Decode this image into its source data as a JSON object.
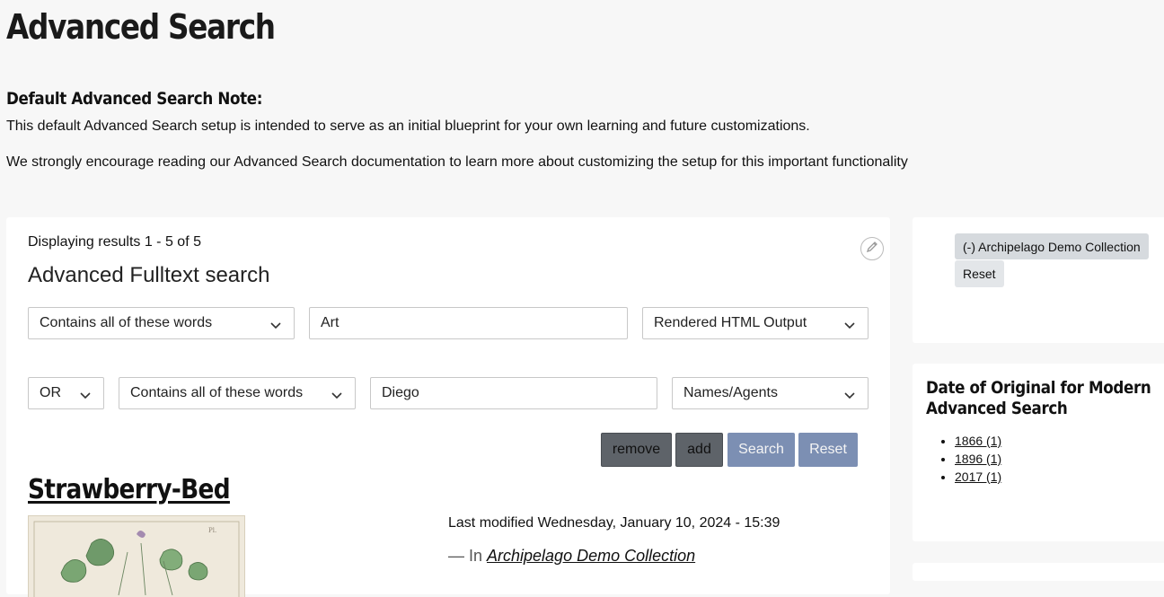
{
  "page": {
    "title": "Advanced Search"
  },
  "note": {
    "heading": "Default Advanced Search Note:",
    "paragraph1": "This default Advanced Search setup is intended to serve as an initial blueprint for your own learning and future customizations.",
    "p2_before": "We strongly encourage reading our ",
    "p2_link": "Advanced Search documentation",
    "p2_after": " to learn more about customizing the setup for this important functionality"
  },
  "results": {
    "summary": "Displaying results 1 - 5 of 5"
  },
  "form": {
    "title": "Advanced Fulltext search",
    "row1": {
      "condition": "Contains all of these words",
      "value": "Art",
      "field": "Rendered HTML Output"
    },
    "row2": {
      "operator": "OR",
      "condition": "Contains all of these words",
      "value": "Diego",
      "field": "Names/Agents"
    },
    "buttons": {
      "remove": "remove",
      "add": "add",
      "search": "Search",
      "reset": "Reset"
    }
  },
  "result_item": {
    "title": "Strawberry-Bed",
    "modified": "Last modified Wednesday, January 10, 2024 - 15:39",
    "in_prefix": "— In ",
    "collection": "Archipelago Demo Collection"
  },
  "sidebar": {
    "active_filter": "(-) Archipelago Demo Collection",
    "reset_label": "Reset",
    "facet_title": "Date of Original for Modern Advanced Search",
    "facet_items": [
      "1866 (1)",
      "1896 (1)",
      "2017 (1)"
    ]
  },
  "icons": {
    "edit": "pencil-icon",
    "dropdown": "chevron-down-icon"
  },
  "colors": {
    "primary_button": "#7c8fb3",
    "dark_button": "#5e6369",
    "chip": "#d6dade"
  }
}
